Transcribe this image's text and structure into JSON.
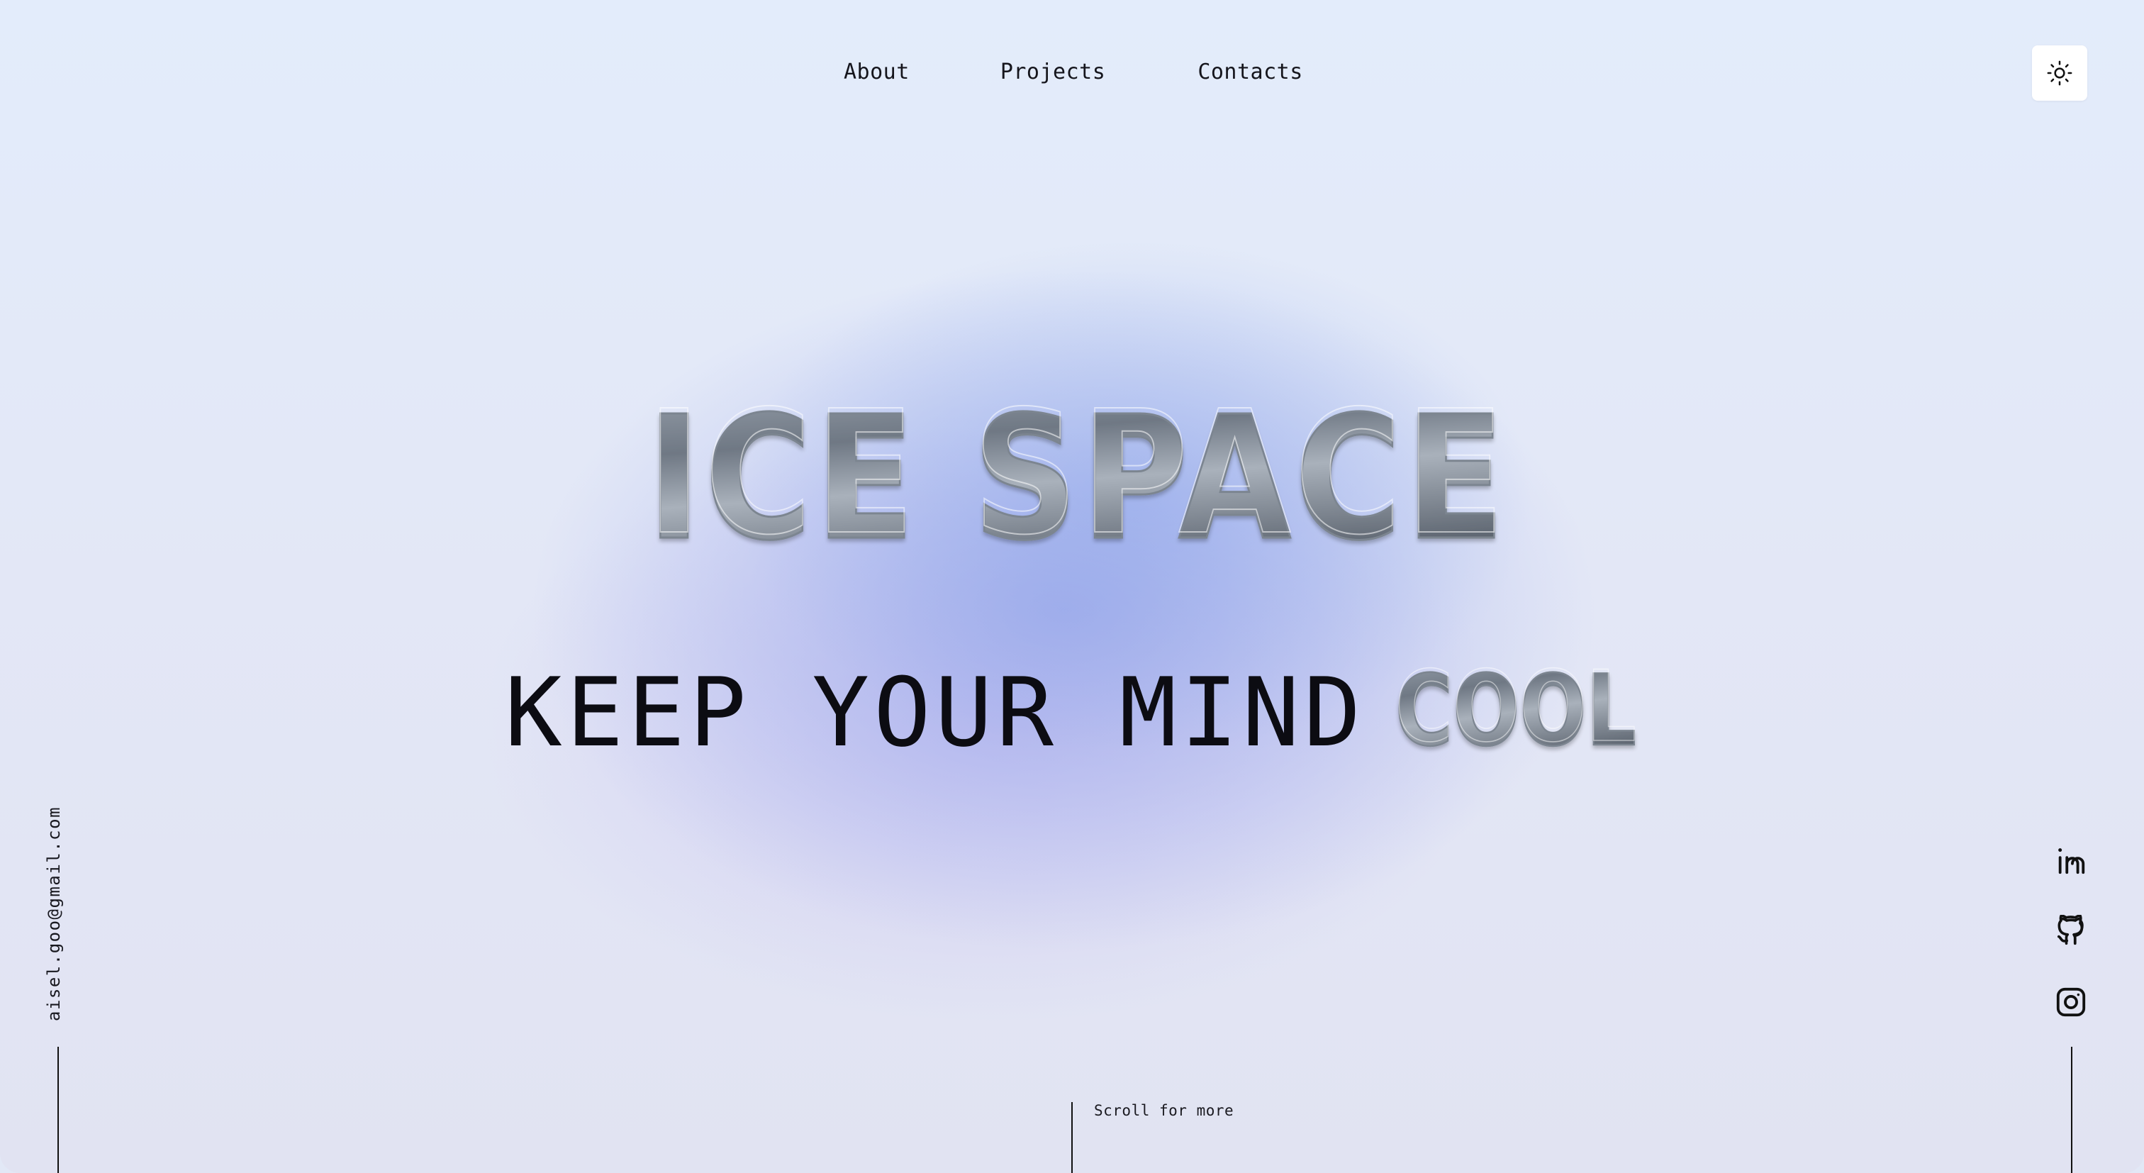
{
  "nav": {
    "items": [
      {
        "label": "About"
      },
      {
        "label": "Projects"
      },
      {
        "label": "Contacts"
      }
    ]
  },
  "theme_toggle": {
    "icon": "sun-icon"
  },
  "hero": {
    "title": "ICE SPACE",
    "tagline": "KEEP YOUR MIND",
    "tagline_highlight": "COOL"
  },
  "contact": {
    "email": "aisel.goo@gmail.com"
  },
  "socials": [
    {
      "icon": "linkedin-icon"
    },
    {
      "icon": "github-icon"
    },
    {
      "icon": "instagram-icon"
    }
  ],
  "scroll": {
    "label": "Scroll for more"
  },
  "colors": {
    "background": "#e2e8f6",
    "text": "#0d0d12",
    "ice_dark": "#5f6772",
    "ice_light": "#c9d0d8"
  }
}
